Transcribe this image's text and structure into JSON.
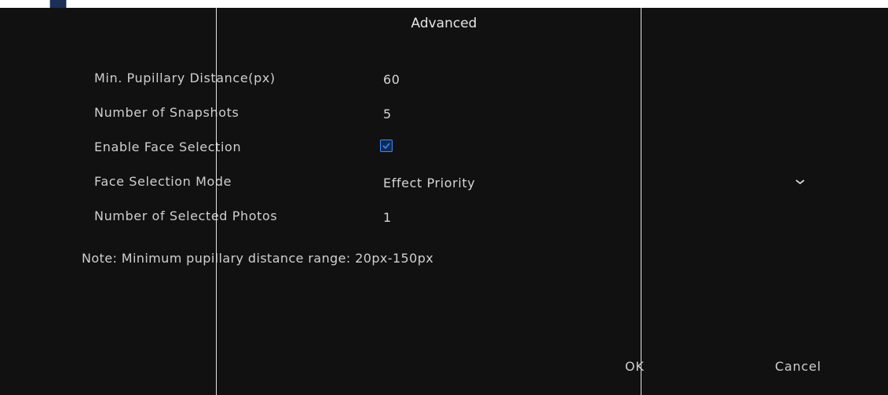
{
  "dialog": {
    "title": "Advanced"
  },
  "fields": [
    {
      "label": "Min. Pupillary Distance(px)",
      "value": "60"
    },
    {
      "label": "Number of Snapshots",
      "value": "5"
    },
    {
      "label": "Enable Face Selection",
      "checked": true
    },
    {
      "label": "Face Selection Mode",
      "value": "Effect Priority"
    },
    {
      "label": "Number of Selected Photos",
      "value": "1"
    }
  ],
  "note": "Note: Minimum pupillary distance range: 20px-150px",
  "buttons": {
    "ok_label": "OK",
    "cancel_label": "Cancel"
  },
  "colors": {
    "background": "#111111",
    "accent": "#3d8af7",
    "text": "#d8d8d8"
  },
  "icons": {
    "checkbox": "checkbox-checked-icon",
    "dropdown": "chevron-down-icon"
  }
}
